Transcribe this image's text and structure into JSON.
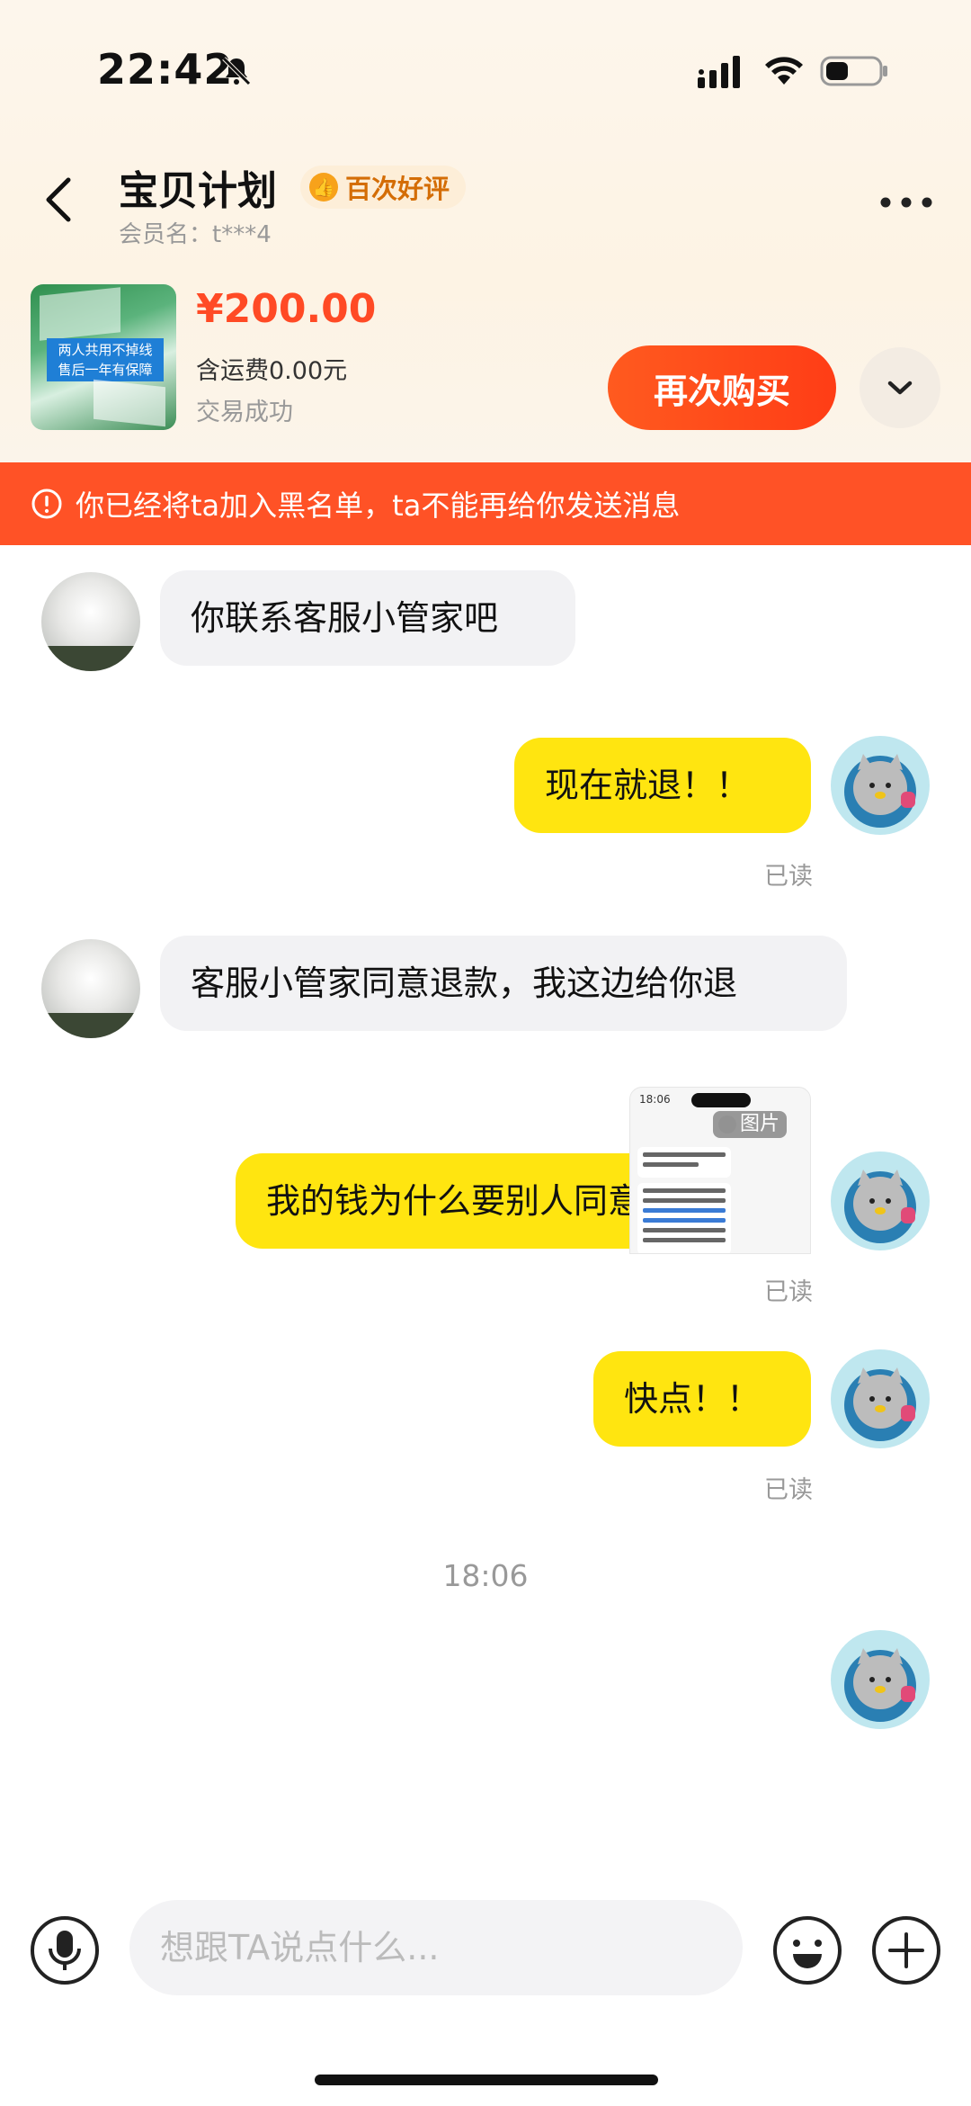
{
  "status_bar": {
    "time": "22:42"
  },
  "header": {
    "shop_name": "宝贝计划",
    "review_badge": "百次好评",
    "member": "会员名：t***4"
  },
  "product": {
    "image_label_line1": "两人共用不掉线",
    "image_label_line2": "售后一年有保障",
    "price": "¥200.00",
    "shipping": "含运费0.00元",
    "status": "交易成功",
    "rebuy_label": "再次购买"
  },
  "banner": {
    "message": "你已经将ta加入黑名单，ta不能再给你发送消息"
  },
  "messages": [
    {
      "side": "left",
      "text": "你联系客服小管家吧"
    },
    {
      "side": "right",
      "text": "现在就退！！",
      "read": "已读"
    },
    {
      "side": "left",
      "text": "客服小管家同意退款，我这边给你退"
    },
    {
      "side": "right",
      "text": "我的钱为什么要别人同意？？",
      "read": "已读"
    },
    {
      "side": "right",
      "text": "快点！！",
      "read": "已读"
    }
  ],
  "time_divider": "18:06",
  "image_message": {
    "label": "图片",
    "status_time": "18:06"
  },
  "input": {
    "placeholder": "想跟TA说点什么..."
  },
  "colors": {
    "accent": "#ff4a25",
    "banner": "#ff5226",
    "bubble_self": "#ffe510",
    "bubble_other": "#f2f2f4"
  }
}
